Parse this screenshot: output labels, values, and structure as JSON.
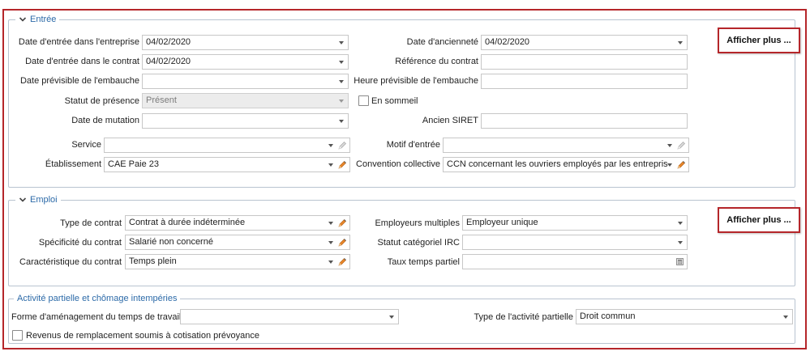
{
  "entree": {
    "title": "Entrée",
    "afficher_plus": "Afficher plus ...",
    "date_entree_entreprise": {
      "label": "Date d'entrée dans l'entreprise",
      "value": "04/02/2020"
    },
    "date_entree_contrat": {
      "label": "Date d'entrée dans le contrat",
      "value": "04/02/2020"
    },
    "date_previsible_embauche": {
      "label": "Date prévisible de l'embauche",
      "value": ""
    },
    "statut_presence": {
      "label": "Statut de présence",
      "value": "Présent"
    },
    "date_mutation": {
      "label": "Date de mutation",
      "value": ""
    },
    "service": {
      "label": "Service",
      "value": ""
    },
    "etablissement": {
      "label": "Établissement",
      "value": "CAE Paie 23"
    },
    "date_anciennete": {
      "label": "Date d'ancienneté",
      "value": "04/02/2020"
    },
    "reference_contrat": {
      "label": "Référence du contrat",
      "value": ""
    },
    "heure_previsible_embauche": {
      "label": "Heure prévisible de l'embauche",
      "value": ""
    },
    "en_sommeil": {
      "label": "En sommeil",
      "checked": false
    },
    "ancien_siret": {
      "label": "Ancien SIRET",
      "value": ""
    },
    "motif_entree": {
      "label": "Motif d'entrée",
      "value": ""
    },
    "convention_collective": {
      "label": "Convention collective",
      "value": "CCN concernant les ouvriers employés par les entrepris"
    }
  },
  "emploi": {
    "title": "Emploi",
    "afficher_plus": "Afficher plus ...",
    "type_contrat": {
      "label": "Type de contrat",
      "value": "Contrat à durée indéterminée"
    },
    "specificite_contrat": {
      "label": "Spécificité du contrat",
      "value": "Salarié non concerné"
    },
    "caracteristique_contrat": {
      "label": "Caractéristique du contrat",
      "value": "Temps plein"
    },
    "employeurs_multiples": {
      "label": "Employeurs multiples",
      "value": "Employeur unique"
    },
    "statut_categoriel_irc": {
      "label": "Statut catégoriel IRC",
      "value": ""
    },
    "taux_temps_partiel": {
      "label": "Taux temps partiel",
      "value": ""
    }
  },
  "activite": {
    "title": "Activité partielle et chômage intempéries",
    "forme_amenagement": {
      "label": "Forme d'aménagement du temps de travail",
      "value": ""
    },
    "type_activite_partielle": {
      "label": "Type de l'activité partielle",
      "value": "Droit commun"
    },
    "revenus_remplacement": {
      "label": "Revenus de remplacement soumis à cotisation prévoyance",
      "checked": false
    }
  },
  "colors": {
    "accent_red": "#b5262a",
    "section_title_blue": "#2c6aa8",
    "pencil_orange": "#e8872a"
  },
  "icons": {
    "chevron": "chevron-down-icon",
    "dropdown": "dropdown-arrow-icon",
    "edit": "pencil-icon",
    "calendar": "calculator-icon"
  }
}
